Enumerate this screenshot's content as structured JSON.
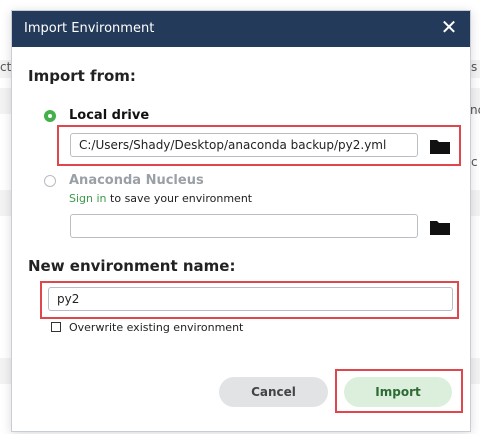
{
  "background": {
    "left_fragment": "ct",
    "right_fragments": [
      "s",
      "nc",
      "c"
    ]
  },
  "dialog": {
    "title": "Import Environment",
    "import_from_label": "Import from:",
    "local_drive": {
      "label": "Local drive",
      "selected": true,
      "path_value": "C:/Users/Shady/Desktop/anaconda backup/py2.yml"
    },
    "anaconda_nucleus": {
      "label": "Anaconda Nucleus",
      "selected": false,
      "sign_in_link": "Sign in",
      "sign_in_suffix": " to save your environment",
      "field_value": ""
    },
    "new_env_label": "New environment name:",
    "env_name_value": "py2",
    "overwrite_label": "Overwrite existing environment",
    "overwrite_checked": false,
    "cancel_label": "Cancel",
    "import_label": "Import"
  },
  "colors": {
    "titlebar": "#243a5a",
    "accent_green": "#43b049",
    "highlight_red": "#e0474c"
  },
  "icons": {
    "close": "close-icon",
    "folder": "folder-icon",
    "radio_on": "radio-selected-icon",
    "radio_off": "radio-unselected-icon"
  }
}
